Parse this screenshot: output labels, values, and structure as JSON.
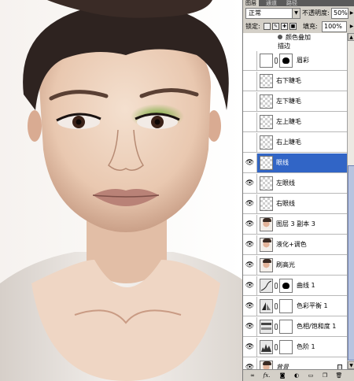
{
  "panel": {
    "tabs": [
      "图层",
      "通道",
      "路径"
    ],
    "blend_mode": "正常",
    "opacity_label": "不透明度:",
    "opacity_value": "50%",
    "lock_label": "锁定:",
    "fill_label": "填充:",
    "fill_value": "100%",
    "effects": [
      "颜色叠加",
      "描边"
    ],
    "layers": [
      {
        "name": "眉彩",
        "visible": false,
        "thumb": "checker",
        "mask": true,
        "selected": false
      },
      {
        "name": "右下睫毛",
        "visible": false,
        "thumb": "checker",
        "selected": false
      },
      {
        "name": "左下睫毛",
        "visible": false,
        "thumb": "checker",
        "selected": false
      },
      {
        "name": "左上睫毛",
        "visible": false,
        "thumb": "checker",
        "selected": false
      },
      {
        "name": "右上睫毛",
        "visible": false,
        "thumb": "checker",
        "selected": false
      },
      {
        "name": "眼线",
        "visible": true,
        "thumb": "checker",
        "selected": true
      },
      {
        "name": "左眼线",
        "visible": true,
        "thumb": "checker",
        "selected": false
      },
      {
        "name": "右眼线",
        "visible": true,
        "thumb": "checker",
        "selected": false
      },
      {
        "name": "图层 3 副本 3",
        "visible": true,
        "thumb": "face",
        "selected": false
      },
      {
        "name": "液化+调色",
        "visible": true,
        "thumb": "face",
        "selected": false
      },
      {
        "name": "刷高光",
        "visible": true,
        "thumb": "face",
        "selected": false
      },
      {
        "name": "曲线 1",
        "visible": true,
        "thumb": "adj",
        "mask": true,
        "selected": false
      },
      {
        "name": "色彩平衡 1",
        "visible": true,
        "thumb": "adj",
        "mask": true,
        "selected": false
      },
      {
        "name": "色相/饱和度 1",
        "visible": true,
        "thumb": "adj",
        "mask": true,
        "selected": false
      },
      {
        "name": "色阶 1",
        "visible": true,
        "thumb": "adj",
        "mask": true,
        "selected": false
      },
      {
        "name": "背景",
        "visible": true,
        "thumb": "face",
        "locked": true,
        "selected": false
      }
    ],
    "bottom_icons": [
      "link-icon",
      "fx-icon",
      "mask-icon",
      "adjustment-icon",
      "folder-icon",
      "new-layer-icon",
      "trash-icon"
    ]
  },
  "colors": {
    "selected_row": "#3165c6",
    "panel_bg": "#d4d0c8",
    "eyeshadow": "#5f9a2c"
  }
}
